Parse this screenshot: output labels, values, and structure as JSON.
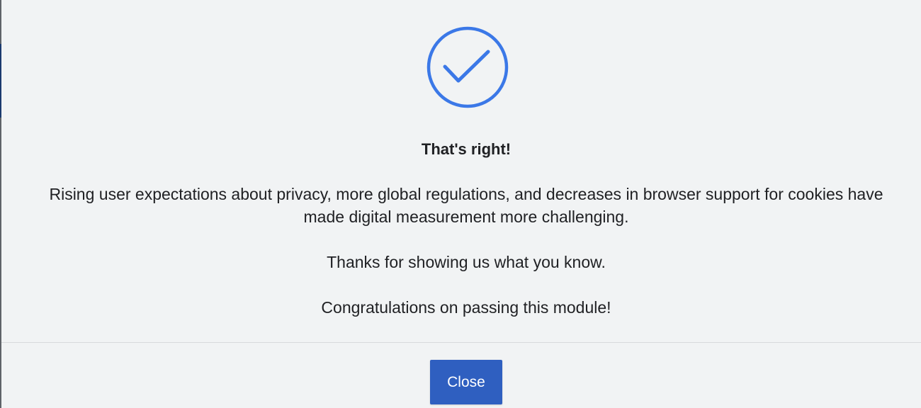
{
  "feedback": {
    "title": "That's right!",
    "message": "Rising user expectations about privacy, more global regulations, and decreases in browser support for cookies have made digital measurement more challenging.",
    "thanks": "Thanks for showing us what you know.",
    "congrats": "Congratulations on passing this module!"
  },
  "actions": {
    "close_label": "Close"
  },
  "icons": {
    "success": "check-circle-icon"
  },
  "colors": {
    "accent": "#3b78e7",
    "button": "#2f5fc0",
    "background": "#f1f3f4",
    "text": "#202124"
  }
}
